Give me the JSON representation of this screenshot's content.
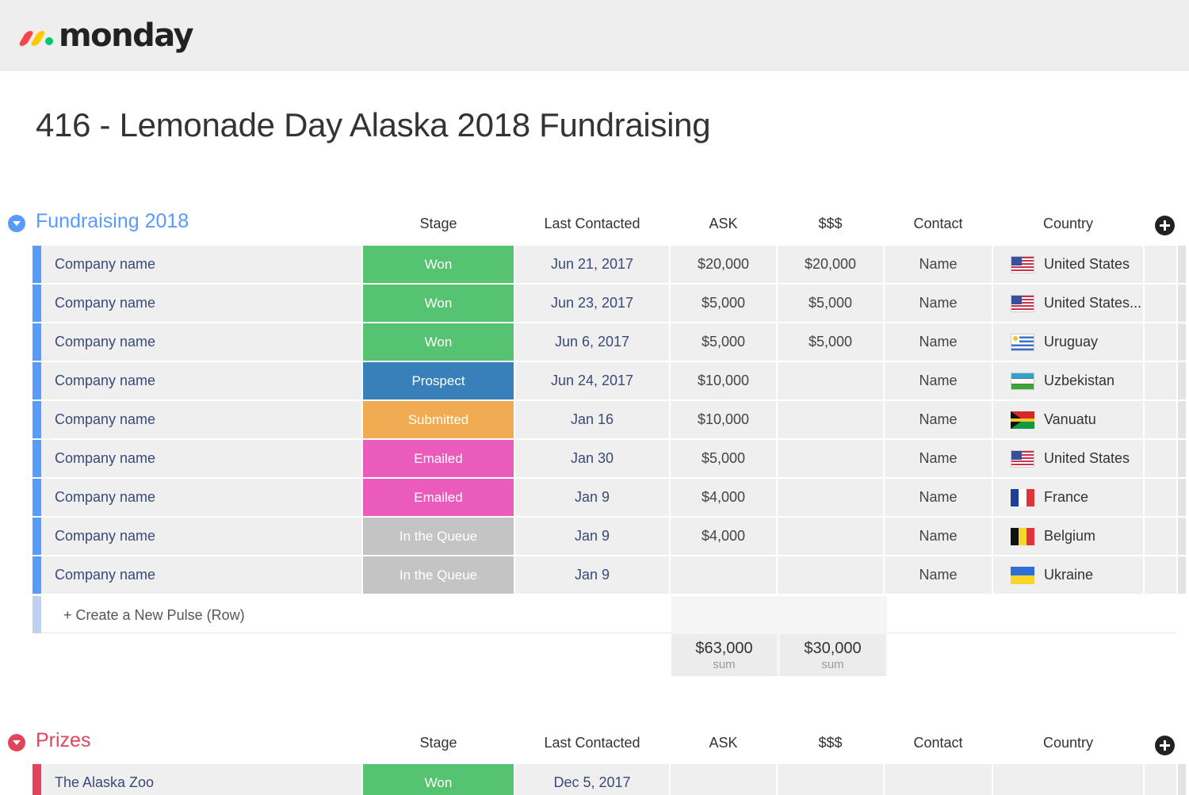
{
  "app": {
    "logo_text": "monday"
  },
  "board": {
    "title": "416 - Lemonade Day Alaska 2018 Fundraising"
  },
  "columns": [
    "Stage",
    "Last Contacted",
    "ASK",
    "$$$",
    "Contact",
    "Country"
  ],
  "colors": {
    "group_fundraising": "#579bfc",
    "group_prizes": "#e2445c",
    "won": "#55c36f",
    "prospect": "#3880b9",
    "submitted": "#f1ab52",
    "emailed": "#ea5bbb",
    "queue": "#c4c4c4"
  },
  "fundraising": {
    "name": "Fundraising 2018",
    "rows": [
      {
        "name": "Company name",
        "stage": "Won",
        "date": "Jun 21, 2017",
        "ask": "$20,000",
        "money": "$20,000",
        "contact": "Name",
        "country": "United States",
        "flag": "us-flag-icon"
      },
      {
        "name": "Company name",
        "stage": "Won",
        "date": "Jun 23, 2017",
        "ask": "$5,000",
        "money": "$5,000",
        "contact": "Name",
        "country": "United States...",
        "flag": "us-flag-icon"
      },
      {
        "name": "Company name",
        "stage": "Won",
        "date": "Jun 6, 2017",
        "ask": "$5,000",
        "money": "$5,000",
        "contact": "Name",
        "country": "Uruguay",
        "flag": "uruguay-flag-icon"
      },
      {
        "name": "Company name",
        "stage": "Prospect",
        "date": "Jun 24, 2017",
        "ask": "$10,000",
        "money": "",
        "contact": "Name",
        "country": "Uzbekistan",
        "flag": "uzbekistan-flag-icon"
      },
      {
        "name": "Company name",
        "stage": "Submitted",
        "date": "Jan 16",
        "ask": "$10,000",
        "money": "",
        "contact": "Name",
        "country": "Vanuatu",
        "flag": "vanuatu-flag-icon"
      },
      {
        "name": "Company name",
        "stage": "Emailed",
        "date": "Jan 30",
        "ask": "$5,000",
        "money": "",
        "contact": "Name",
        "country": "United States",
        "flag": "us-flag-icon"
      },
      {
        "name": "Company name",
        "stage": "Emailed",
        "date": "Jan 9",
        "ask": "$4,000",
        "money": "",
        "contact": "Name",
        "country": "France",
        "flag": "france-flag-icon"
      },
      {
        "name": "Company name",
        "stage": "In the Queue",
        "date": "Jan 9",
        "ask": "$4,000",
        "money": "",
        "contact": "Name",
        "country": "Belgium",
        "flag": "belgium-flag-icon"
      },
      {
        "name": "Company name",
        "stage": "In the Queue",
        "date": "Jan 9",
        "ask": "",
        "money": "",
        "contact": "Name",
        "country": "Ukraine",
        "flag": "ukraine-flag-icon"
      }
    ],
    "new_row_label": "+ Create a New Pulse (Row)",
    "sums": {
      "ask": "$63,000",
      "money": "$30,000",
      "label": "sum"
    }
  },
  "prizes": {
    "name": "Prizes",
    "rows": [
      {
        "name": "The Alaska Zoo",
        "stage": "Won",
        "date": "Dec 5, 2017",
        "ask": "",
        "money": "",
        "contact": "",
        "country": ""
      }
    ]
  }
}
